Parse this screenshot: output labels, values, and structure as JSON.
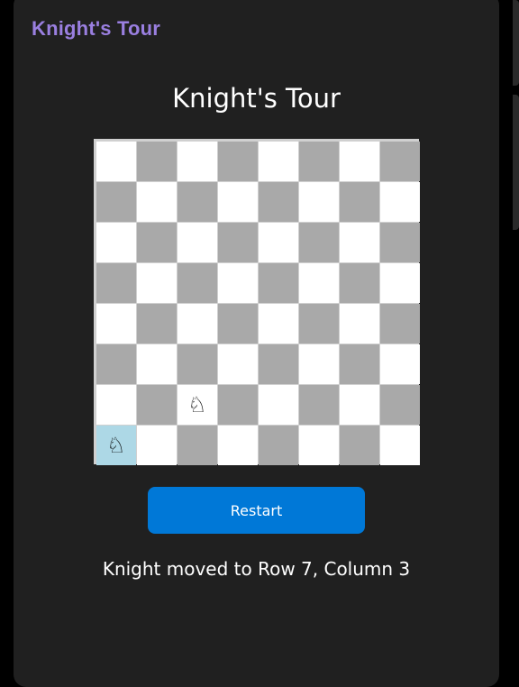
{
  "app_bar": {
    "title": "Knight's Tour"
  },
  "page": {
    "title": "Knight's Tour"
  },
  "board": {
    "rows": 8,
    "cols": 8,
    "colors": {
      "light": "#ffffff",
      "dark": "#a9a9a9",
      "highlight": "#add8e6"
    },
    "knight_glyph": "♘",
    "knights": [
      {
        "row": 7,
        "col": 3,
        "icon": "knight-icon"
      },
      {
        "row": 8,
        "col": 1,
        "icon": "knight-icon",
        "highlighted": true
      }
    ]
  },
  "controls": {
    "restart_label": "Restart"
  },
  "status": {
    "message": "Knight moved to Row 7, Column 3"
  },
  "theme": {
    "accent": "#9a7fe0",
    "button": "#0078d7",
    "background": "#202020"
  }
}
